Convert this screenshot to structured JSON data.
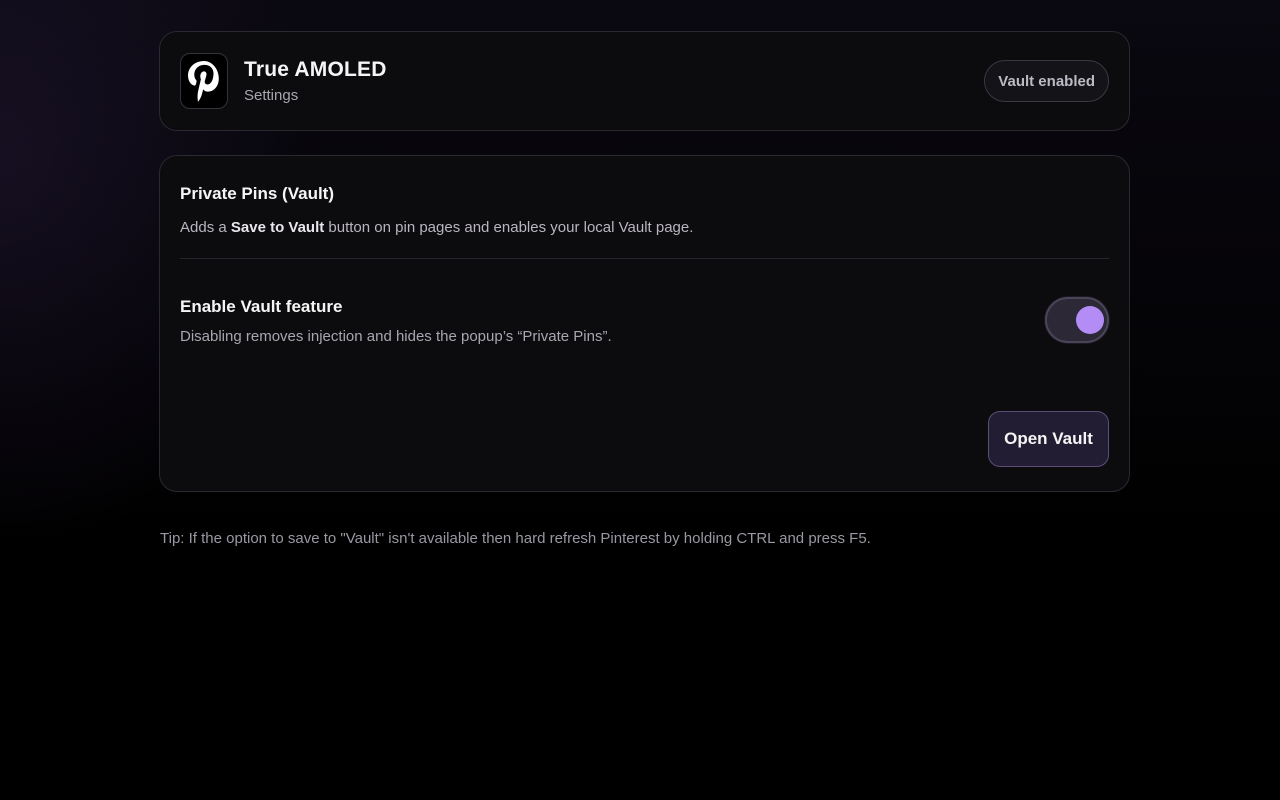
{
  "header": {
    "app_icon": "pinterest-logo-icon",
    "title": "True AMOLED",
    "subtitle": "Settings",
    "badge": "Vault enabled"
  },
  "vault_section": {
    "title": "Private Pins (Vault)",
    "description_prefix": "Adds a ",
    "description_bold": "Save to Vault",
    "description_suffix": " button on pin pages and enables your local Vault page.",
    "feature_title": "Enable Vault feature",
    "feature_description": "Disabling removes injection and hides the popup’s “Private Pins”.",
    "toggle_on": true,
    "open_button": "Open Vault"
  },
  "tip": "Tip: If the option to save to \"Vault\" isn't available then hard refresh Pinterest by holding CTRL and press F5.",
  "colors": {
    "accent": "#b48cf6",
    "background": "#000000",
    "card": "#0c0b0e"
  }
}
